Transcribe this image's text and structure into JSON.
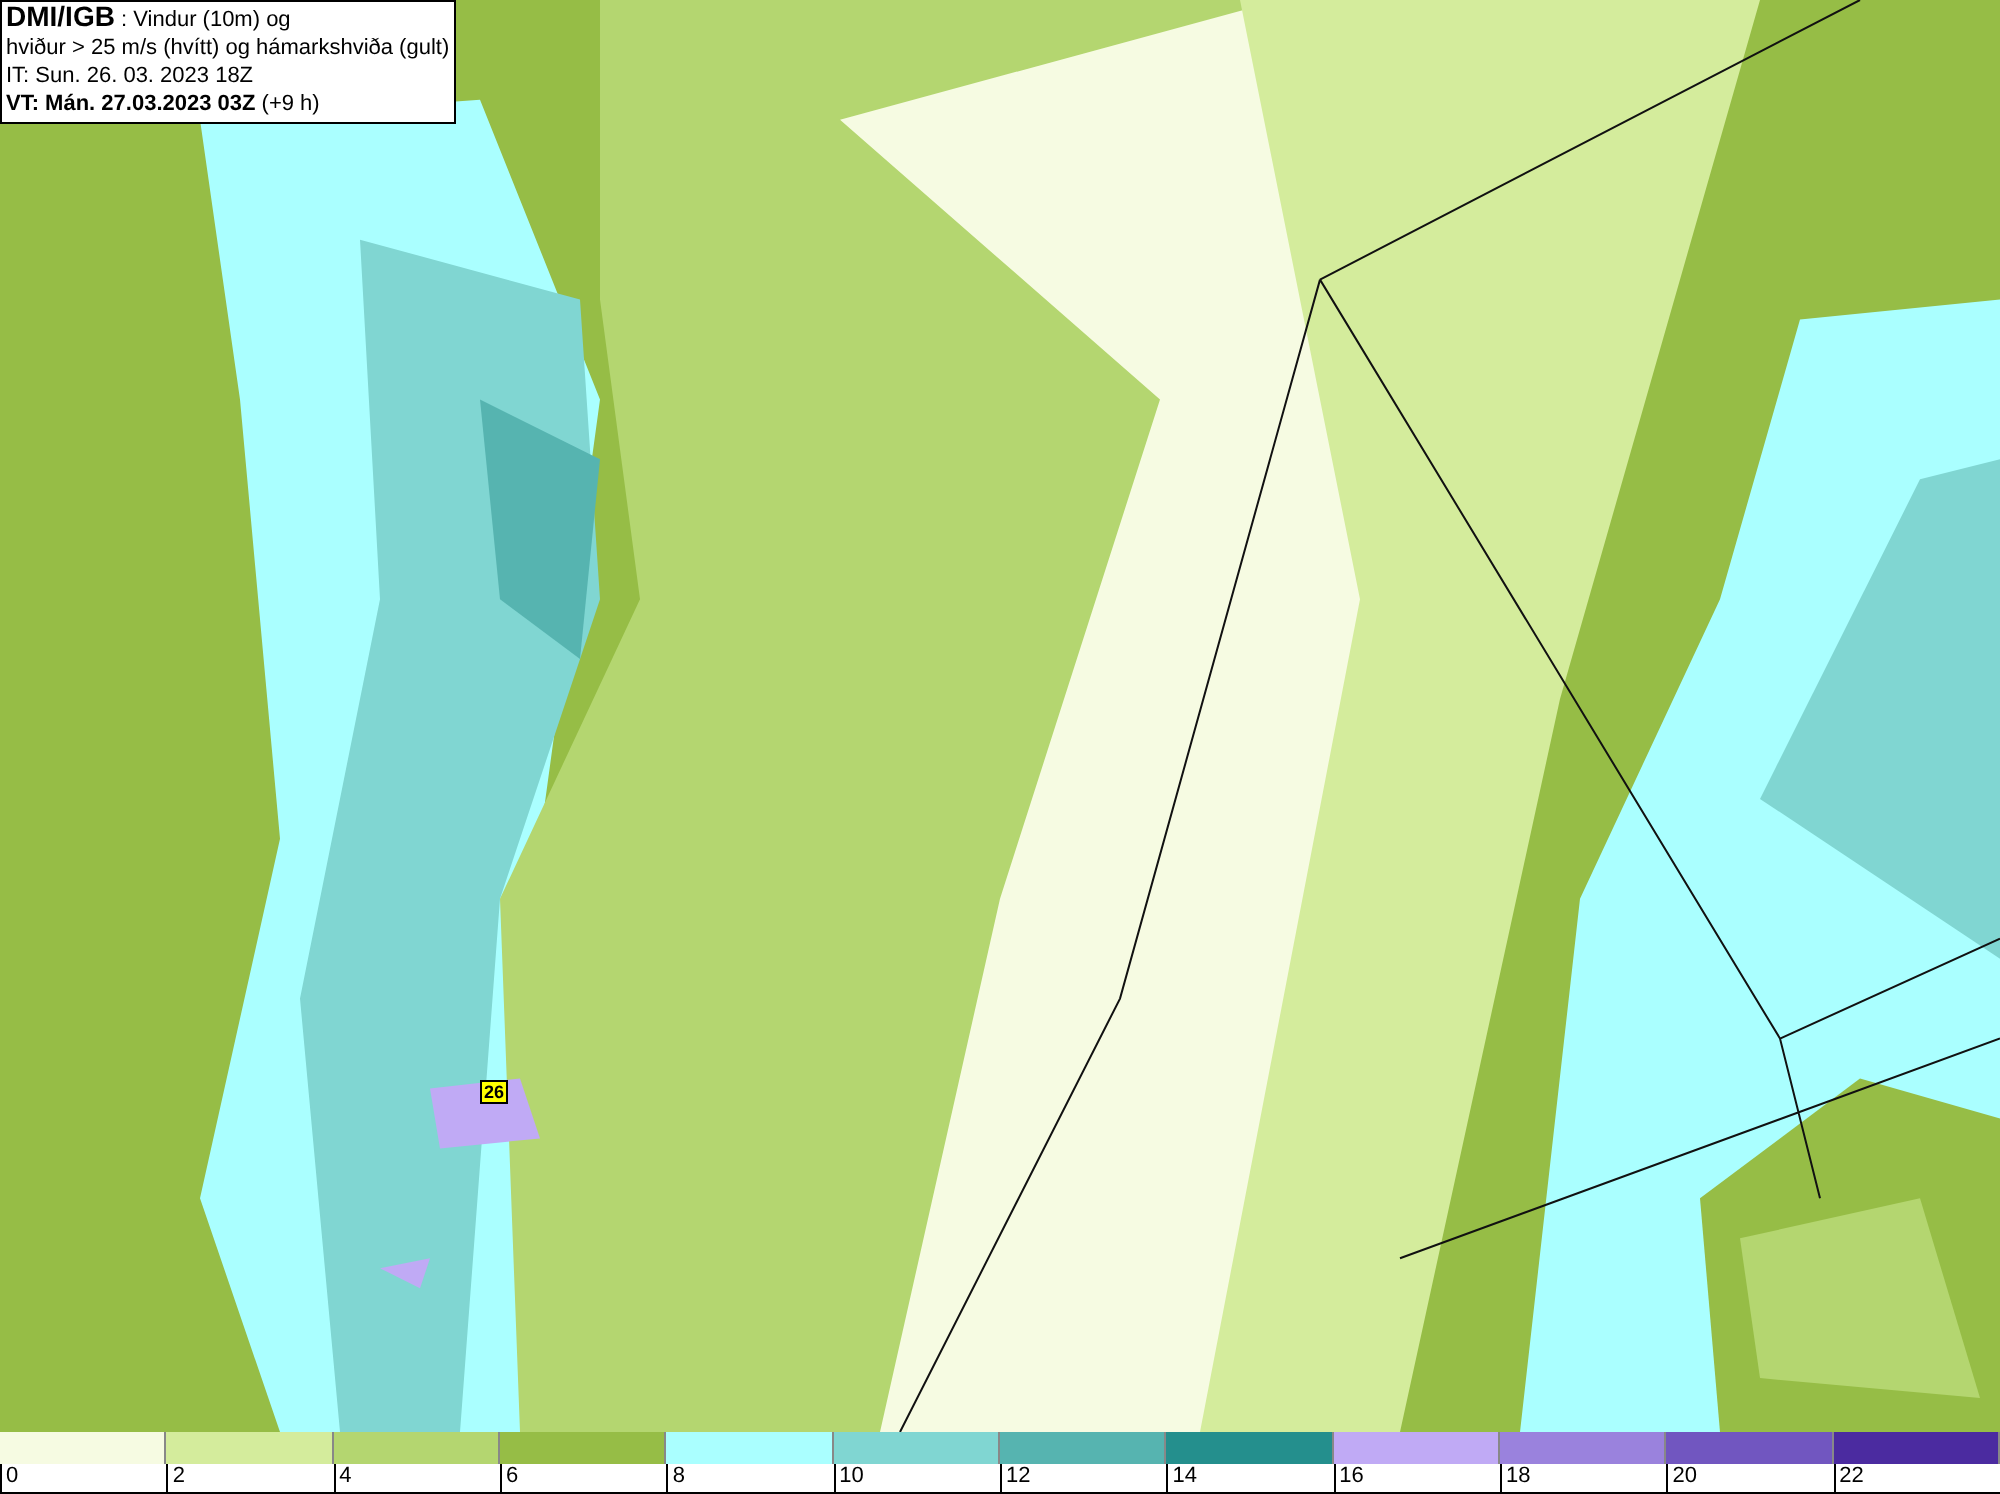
{
  "header": {
    "source": "DMI/IGB",
    "title": ": Vindur (10m) og",
    "subtitle": "hviður > 25 m/s (hvítt) og hámarkshviða (gult)",
    "issue_time": "IT: Sun. 26. 03. 2023 18Z",
    "valid_time": "VT: Mán. 27.03.2023 03Z",
    "valid_offset": "(+9 h)"
  },
  "map": {
    "gust_label": "26"
  },
  "legend": {
    "segments": [
      {
        "color": "#f6fbe2"
      },
      {
        "color": "#d4ec9c"
      },
      {
        "color": "#b4d670"
      },
      {
        "color": "#96bd46"
      },
      {
        "color": "#aaffff"
      },
      {
        "color": "#80d6d2"
      },
      {
        "color": "#56b4b0"
      },
      {
        "color": "#248f8d"
      },
      {
        "color": "#c0aaf5"
      },
      {
        "color": "#9a82dd"
      },
      {
        "color": "#7156c0"
      },
      {
        "color": "#4b2ba0"
      }
    ],
    "ticks": [
      "0",
      "2",
      "4",
      "6",
      "8",
      "10",
      "12",
      "14",
      "16",
      "18",
      "20",
      "22"
    ]
  }
}
